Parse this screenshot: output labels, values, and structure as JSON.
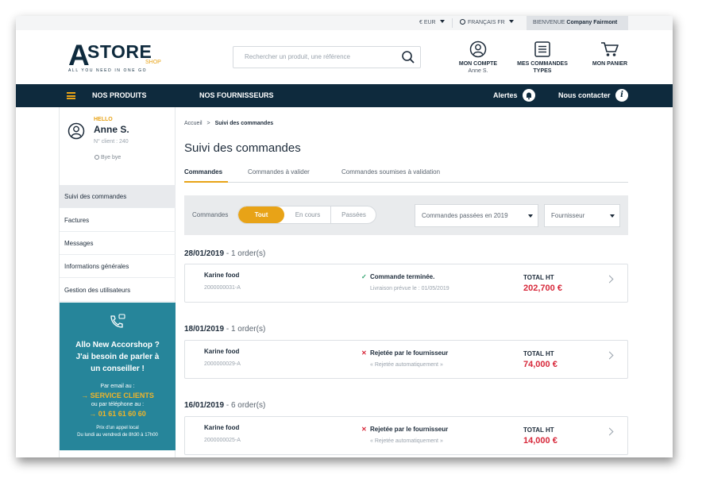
{
  "topbar": {
    "currency": "€ EUR",
    "language": "FRANÇAIS FR",
    "welcome_label": "BIENVENUE",
    "welcome_company": "Company Fairmont"
  },
  "logo": {
    "letter": "A",
    "word": "STORE",
    "sub": "SHOP",
    "tagline": "ALL YOU NEED IN ONE GO"
  },
  "search": {
    "placeholder": "Rechercher un produit, une référence"
  },
  "header_actions": {
    "account_label": "MON COMPTE",
    "account_user": "Anne S.",
    "orders_label_1": "MES COMMANDES",
    "orders_label_2": "TYPES",
    "cart_label": "MON PANIER"
  },
  "nav": {
    "products": "NOS PRODUITS",
    "suppliers": "NOS FOURNISSEURS",
    "alerts": "Alertes",
    "contact": "Nous contacter"
  },
  "sidebar": {
    "hello": "HELLO",
    "name": "Anne S.",
    "client": "N° client : 240",
    "logout": "Bye bye",
    "items": [
      {
        "label": "Suivi des commandes",
        "active": true
      },
      {
        "label": "Factures",
        "active": false
      },
      {
        "label": "Messages",
        "active": false
      },
      {
        "label": "Informations générales",
        "active": false
      },
      {
        "label": "Gestion des utilisateurs",
        "active": false
      }
    ],
    "promo": {
      "title_1": "Allo New Accorshop ?",
      "title_2": "J'ai besoin de parler à",
      "title_3": "un conseiller !",
      "by_email": "Par email au :",
      "service": "SERVICE CLIENTS",
      "by_phone": "ou par téléphone au :",
      "phone": "01 61 61 60 60",
      "price": "Prix d'un appel local",
      "hours": "Du lundi au vendredi de 8h30 à 17h00"
    }
  },
  "breadcrumb": {
    "home": "Accueil",
    "sep": ">",
    "current": "Suivi des commandes"
  },
  "page_title": "Suivi des commandes",
  "tabs": [
    {
      "label": "Commandes",
      "active": true
    },
    {
      "label": "Commandes à valider",
      "active": false
    },
    {
      "label": "Commandes soumises à validation",
      "active": false
    }
  ],
  "filters": {
    "label": "Commandes",
    "segments": [
      "Tout",
      "En cours",
      "Passées"
    ],
    "selected_segment": "Tout",
    "period": "Commandes passées en 2019",
    "supplier": "Fournisseur"
  },
  "order_groups": [
    {
      "date": "28/01/2019",
      "count": "- 1 order(s)",
      "orders": [
        {
          "supplier": "Karine food",
          "ref": "2000000031-A",
          "status_icon": "✓",
          "status": "Commande terminée.",
          "detail": "Livraison prévue le : 01/05/2019",
          "total_label": "TOTAL HT",
          "total": "202,700 €"
        }
      ]
    },
    {
      "date": "18/01/2019",
      "count": "- 1 order(s)",
      "orders": [
        {
          "supplier": "Karine food",
          "ref": "2000000029-A",
          "status_icon": "✕",
          "status": "Rejetée par le fournisseur",
          "detail": "« Rejetée automatiquement »",
          "total_label": "TOTAL HT",
          "total": "74,000 €"
        }
      ]
    },
    {
      "date": "16/01/2019",
      "count": "- 6 order(s)",
      "orders": [
        {
          "supplier": "Karine food",
          "ref": "2000000025-A",
          "status_icon": "✕",
          "status": "Rejetée par le fournisseur",
          "detail": "« Rejetée automatiquement »",
          "total_label": "TOTAL HT",
          "total": "14,000 €"
        }
      ]
    }
  ],
  "colors": {
    "navy": "#0e2a3d",
    "accent": "#e8a317",
    "promo_teal": "#26859a",
    "success": "#2aa16a",
    "danger": "#d7283a"
  },
  "icons": {
    "account": "user-circle-icon",
    "orders": "list-icon",
    "cart": "cart-icon",
    "alerts": "bell-icon",
    "contact": "info-icon",
    "phone": "phone-icon"
  }
}
